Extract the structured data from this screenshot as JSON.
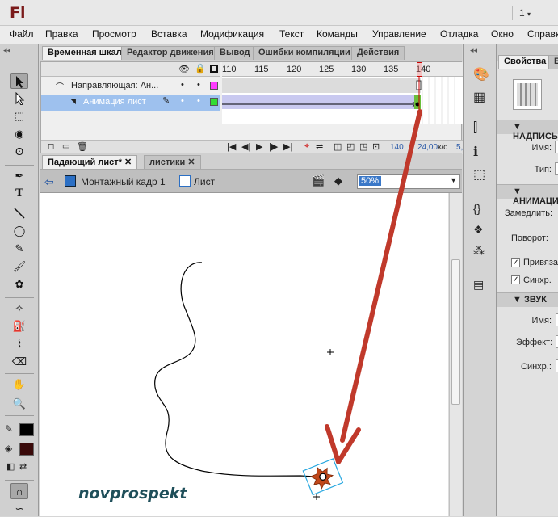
{
  "app": {
    "logo": "Fl",
    "workspace_number": "1"
  },
  "menu": [
    "Файл",
    "Правка",
    "Просмотр",
    "Вставка",
    "Модификация",
    "Текст",
    "Команды",
    "Управление",
    "Отладка",
    "Окно",
    "Справк"
  ],
  "timeline": {
    "tabs": [
      "Временная шкала",
      "Редактор движения",
      "Вывод",
      "Ошибки компиляции",
      "Действия"
    ],
    "frame_numbers": [
      "110",
      "115",
      "120",
      "125",
      "130",
      "135",
      "140"
    ],
    "layers": [
      {
        "name": "Направляющая: Ан...",
        "type": "guide",
        "color": "#ff3cff"
      },
      {
        "name": "Анимация лист",
        "type": "normal",
        "color": "#33dd33"
      }
    ],
    "status": {
      "current_frame": "140",
      "fps": "24,00",
      "fps_unit": "к/с",
      "elapsed": "5,"
    }
  },
  "documents": {
    "tabs": [
      "Падающий лист*",
      "листики"
    ],
    "breadcrumb": {
      "scene": "Монтажный кадр 1",
      "symbol": "Лист"
    },
    "zoom": "50%"
  },
  "stage": {
    "watermark": "novprospekt"
  },
  "properties": {
    "tabs": [
      "Свойства",
      "Б"
    ],
    "sections": {
      "label": {
        "title": "НАДПИСЬ",
        "name_label": "Имя:",
        "type_label": "Тип:"
      },
      "animation": {
        "title": "АНИМАЦИЯ",
        "ease_label": "Замедлить:",
        "rotate_label": "Поворот:",
        "orient_label": "Привяза",
        "sync_label": "Синхр."
      },
      "sound": {
        "title": "ЗВУК",
        "name_label": "Имя:",
        "effect_label": "Эффект:",
        "sync_label": "Синхр.:"
      }
    }
  },
  "colors": {
    "arrow": "#c0392b",
    "selected_layer": "#9ec1ee",
    "watermark": "#1f4f5a",
    "tween_span": "#c9c9f0"
  }
}
